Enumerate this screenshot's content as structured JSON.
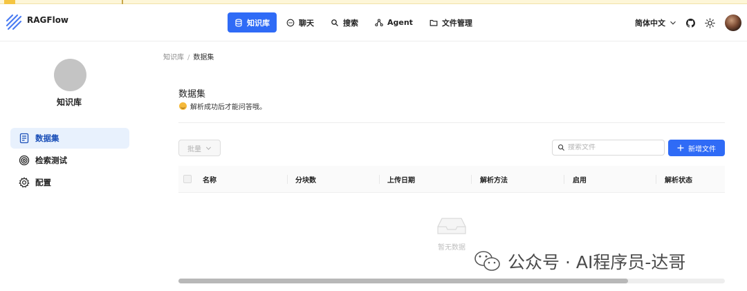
{
  "app": {
    "brand": "RAGFlow"
  },
  "nav": {
    "items": [
      {
        "label": "知识库",
        "icon": "database-icon",
        "active": true
      },
      {
        "label": "聊天",
        "icon": "chat-icon",
        "active": false
      },
      {
        "label": "搜索",
        "icon": "search-icon",
        "active": false
      },
      {
        "label": "Agent",
        "icon": "agent-icon",
        "active": false
      },
      {
        "label": "文件管理",
        "icon": "folder-icon",
        "active": false
      }
    ]
  },
  "header": {
    "language": "简体中文"
  },
  "sidebar": {
    "kb_name": "知识库",
    "items": [
      {
        "label": "数据集",
        "icon": "document-icon",
        "active": true
      },
      {
        "label": "检索测试",
        "icon": "target-icon",
        "active": false
      },
      {
        "label": "配置",
        "icon": "gear-icon",
        "active": false
      }
    ]
  },
  "breadcrumb": {
    "root": "知识库",
    "separator": "/",
    "current": "数据集"
  },
  "main": {
    "title": "数据集",
    "subtitle": "解析成功后才能问答哦。",
    "batch_label": "批量",
    "search_placeholder": "搜索文件",
    "add_label": "新增文件",
    "columns": [
      "名称",
      "分块数",
      "上传日期",
      "解析方法",
      "启用",
      "解析状态"
    ],
    "empty_text": "暂无数据"
  },
  "watermark": {
    "text": "公众号 · AI程序员-达哥"
  },
  "scroll": {
    "position_fraction": 0.82
  },
  "colors": {
    "accent": "#2f6bf6",
    "active_bg": "#e8f1fd"
  }
}
